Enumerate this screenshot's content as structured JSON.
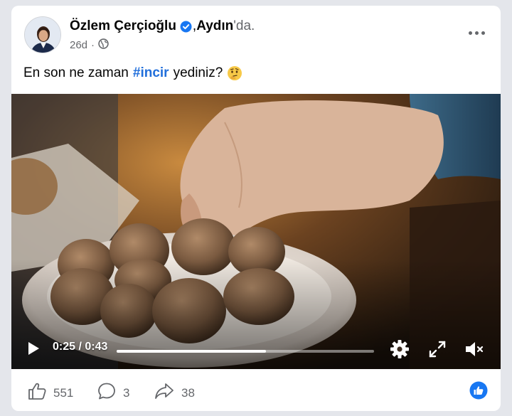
{
  "post": {
    "author": "Özlem Çerçioğlu",
    "location_sep": ", ",
    "location": "Aydın",
    "location_suffix": "'da.",
    "time": "26d",
    "meta_dot": "·",
    "text_before": "En son ne zaman",
    "hashtag": "#incir",
    "text_after": "yediniz?",
    "emoji": "thinking-face"
  },
  "video": {
    "time_display": "0:25 / 0:43",
    "progress": 0.58
  },
  "stats": {
    "likes": "551",
    "comments": "3",
    "shares": "38"
  },
  "icons": [
    "verified-icon",
    "globe-icon",
    "more-options-icon",
    "play-icon",
    "settings-icon",
    "fullscreen-icon",
    "mute-icon",
    "like-icon",
    "comment-icon",
    "share-icon",
    "like-badge-icon"
  ],
  "colors": {
    "link": "#216fdb",
    "verified": "#1877f2",
    "text": "#050505",
    "muted": "#65676b",
    "page_bg": "#e4e6eb"
  }
}
